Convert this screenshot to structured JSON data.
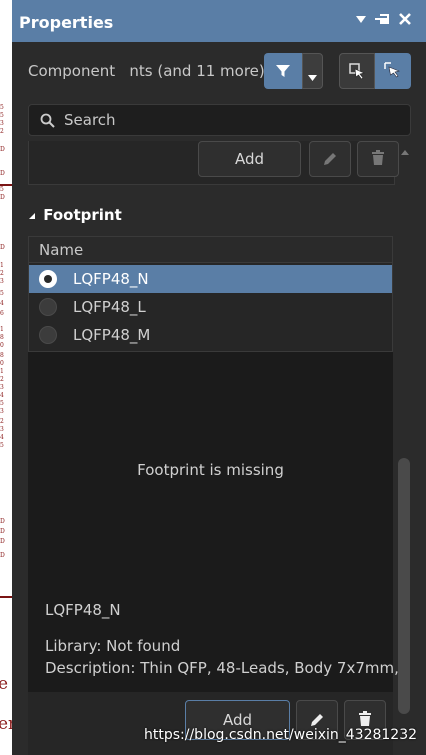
{
  "panel": {
    "title": "Properties",
    "title_icons": [
      "dropdown-arrow-icon",
      "pin-icon",
      "close-icon"
    ]
  },
  "filter": {
    "text": "Component   nts (and 11 more)",
    "filter_icon": "funnel-icon",
    "dropdown_icon": "chevron-down-icon",
    "select_icons": [
      "select-objects-icon",
      "select-cursor-icon"
    ]
  },
  "search": {
    "placeholder": "Search"
  },
  "top_actions": {
    "add_label": "Add",
    "edit_icon": "pencil-icon",
    "delete_icon": "trash-icon"
  },
  "footprint": {
    "section_title": "Footprint",
    "column_header": "Name",
    "rows": [
      {
        "name": "LQFP48_N",
        "selected": true
      },
      {
        "name": "LQFP48_L",
        "selected": false
      },
      {
        "name": "LQFP48_M",
        "selected": false
      }
    ]
  },
  "preview": {
    "message": "Footprint is missing",
    "name": "LQFP48_N",
    "library": "Library: Not found",
    "description": "Description: Thin QFP, 48-Leads, Body 7x7mm,"
  },
  "bottom_actions": {
    "add_label": "Add",
    "edit_icon": "pencil-icon",
    "delete_icon": "trash-icon"
  },
  "watermark": "https://blog.csdn.net/weixin_43281232",
  "colors": {
    "panel_bg": "#2b2b2b",
    "accent": "#5a7ea6",
    "preview_bg": "#1b1b1b",
    "schematic_red": "#8b1c1c"
  }
}
